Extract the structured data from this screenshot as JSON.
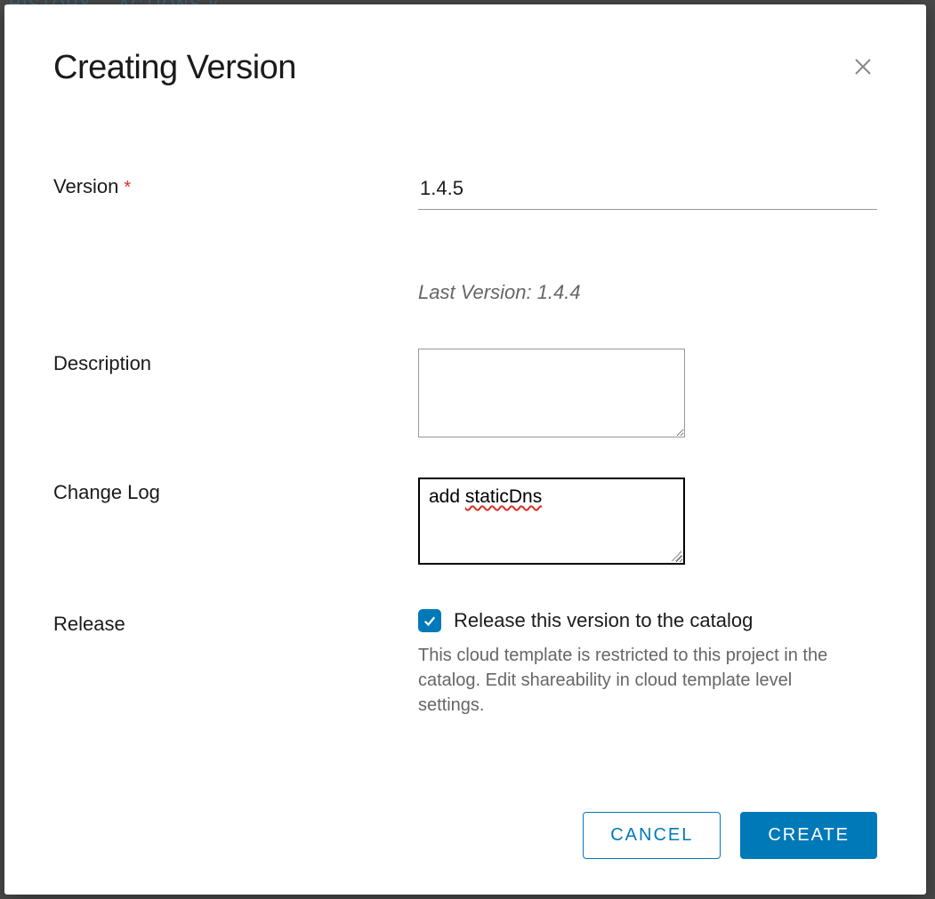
{
  "backdrop": {
    "nav1": "HISTORY",
    "nav2": "ACTIONS"
  },
  "modal": {
    "title": "Creating Version"
  },
  "form": {
    "version": {
      "label": "Version",
      "required_marker": "*",
      "value": "1.4.5",
      "last_version_label": "Last Version: 1.4.4"
    },
    "description": {
      "label": "Description",
      "value": ""
    },
    "changelog": {
      "label": "Change Log",
      "prefix": "add ",
      "misspelled": "staticDns"
    },
    "release": {
      "label": "Release",
      "checkbox_label": "Release this version to the catalog",
      "checked": true,
      "helper": "This cloud template is restricted to this project in the catalog. Edit shareability in cloud template level settings."
    }
  },
  "actions": {
    "cancel": "CANCEL",
    "create": "CREATE"
  }
}
